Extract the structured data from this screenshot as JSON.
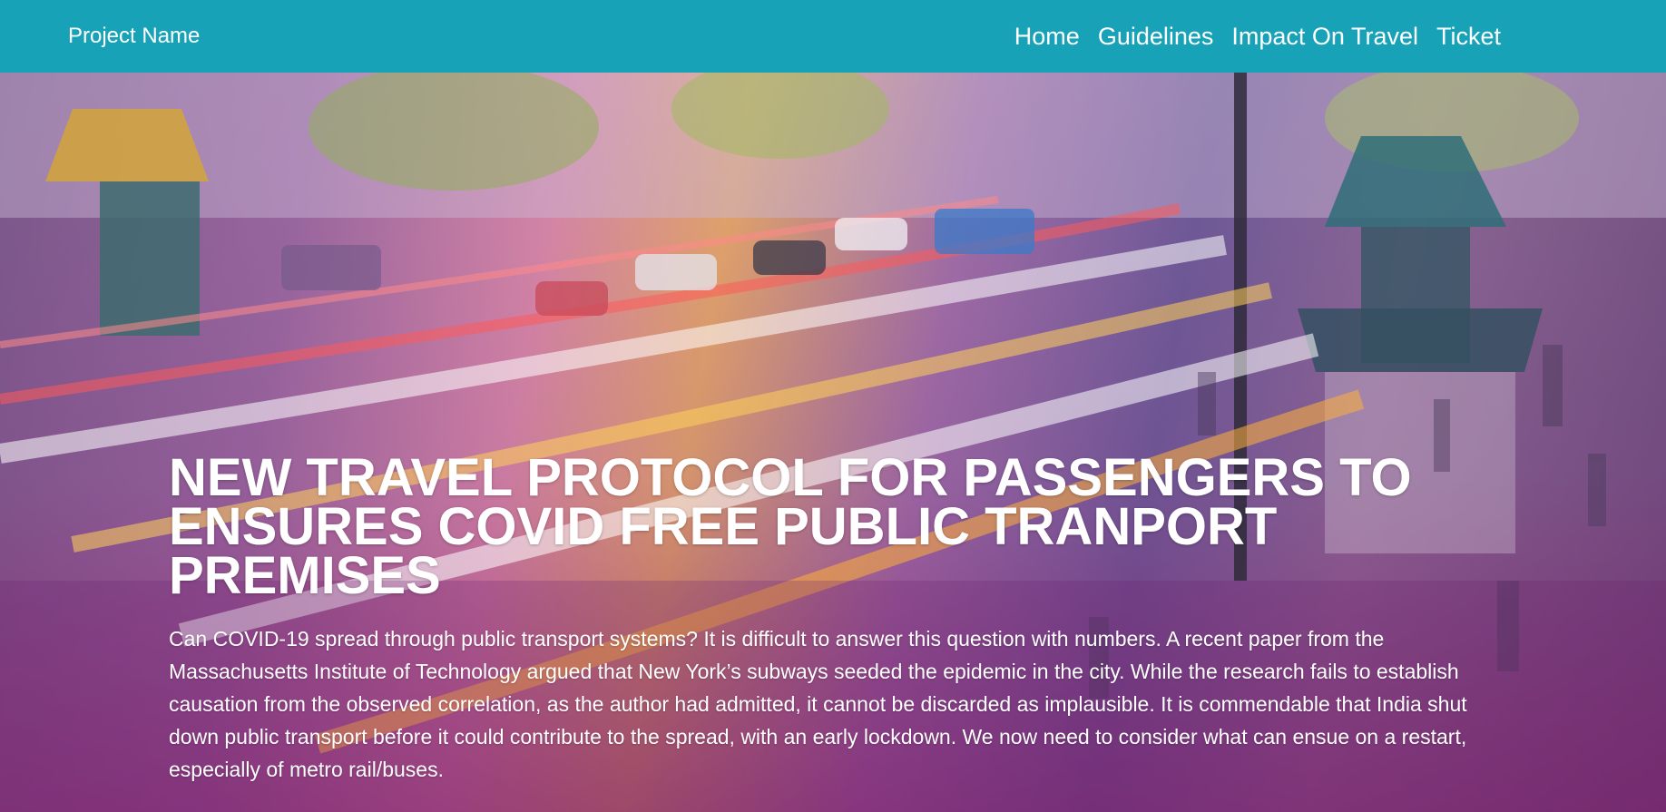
{
  "navbar": {
    "brand": "Project Name",
    "links": [
      "Home",
      "Guidelines",
      "Impact On Travel",
      "Ticket"
    ]
  },
  "hero": {
    "title": "NEW TRAVEL PROTOCOL FOR PASSENGERS TO ENSURES COVID FREE PUBLIC TRANPORT PREMISES",
    "body": "Can COVID-19 spread through public transport systems? It is difficult to answer this question with numbers. A recent paper from the Massachusetts Institute of Technology argued that New York’s subways seeded the epidemic in the city. While the research fails to establish causation from the observed correlation, as the author had admitted, it cannot be discarded as implausible. It is commendable that India shut down public transport before it could contribute to the spread, with an early lockdown. We now need to consider what can ensue on a restart, especially of metro rail/buses."
  },
  "colors": {
    "navbar": "#17a2b8",
    "text": "#ffffff"
  }
}
